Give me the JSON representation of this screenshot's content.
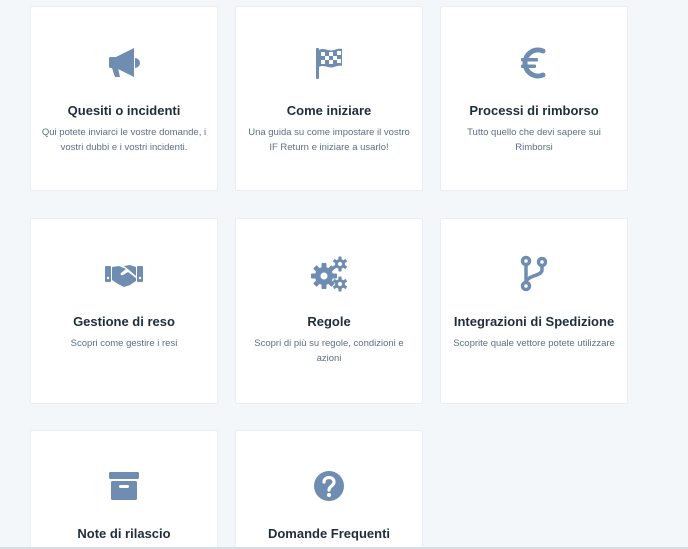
{
  "colors": {
    "background": "#f4f7fa",
    "card": "#ffffff",
    "icon": "#6f8db0",
    "title": "#1f2d3d",
    "description": "#5c6f84"
  },
  "cards": [
    {
      "icon": "megaphone-icon",
      "title": "Quesiti o incidenti",
      "description": "Qui potete inviarci le vostre domande, i vostri dubbi e i vostri incidenti."
    },
    {
      "icon": "checkered-flag-icon",
      "title": "Come iniziare",
      "description": "Una guida su come impostare il vostro IF Return e iniziare a usarlo!"
    },
    {
      "icon": "euro-icon",
      "title": "Processi di rimborso",
      "description": "Tutto quello che devi sapere sui Rimborsi"
    },
    {
      "icon": "handshake-icon",
      "title": "Gestione di reso",
      "description": "Scopri come gestire i resi"
    },
    {
      "icon": "gears-icon",
      "title": "Regole",
      "description": "Scopri di più su regole, condizioni e azioni"
    },
    {
      "icon": "code-branch-icon",
      "title": "Integrazioni di Spedizione",
      "description": "Scoprite quale vettore potete utilizzare"
    },
    {
      "icon": "archive-box-icon",
      "title": "Note di rilascio",
      "description": ""
    },
    {
      "icon": "question-circle-icon",
      "title": "Domande Frequenti",
      "description": ""
    }
  ]
}
